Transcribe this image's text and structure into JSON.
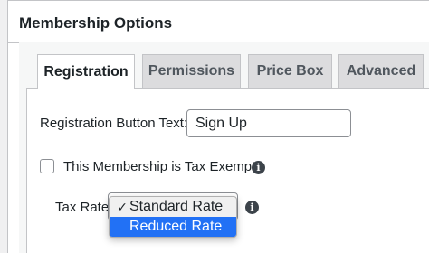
{
  "panel": {
    "title": "Membership Options"
  },
  "tabs": [
    {
      "label": "Registration",
      "active": true
    },
    {
      "label": "Permissions",
      "active": false
    },
    {
      "label": "Price Box",
      "active": false
    },
    {
      "label": "Advanced",
      "active": false
    }
  ],
  "registration": {
    "button_text_label": "Registration Button Text:",
    "button_text_value": "Sign Up",
    "tax_exempt_label": "This Membership is Tax Exempt",
    "tax_exempt_checked": false,
    "tax_rates_label": "Tax Rates",
    "tax_rates_options": [
      {
        "label": "Standard Rate",
        "selected": true
      },
      {
        "label": "Reduced Rate",
        "selected": false,
        "highlighted": true
      }
    ],
    "check_mark": "✓",
    "info_glyph": "i"
  },
  "colors": {
    "highlight": "#2271f5",
    "tab_inactive": "#dcdcde",
    "border": "#c3c4c7"
  }
}
